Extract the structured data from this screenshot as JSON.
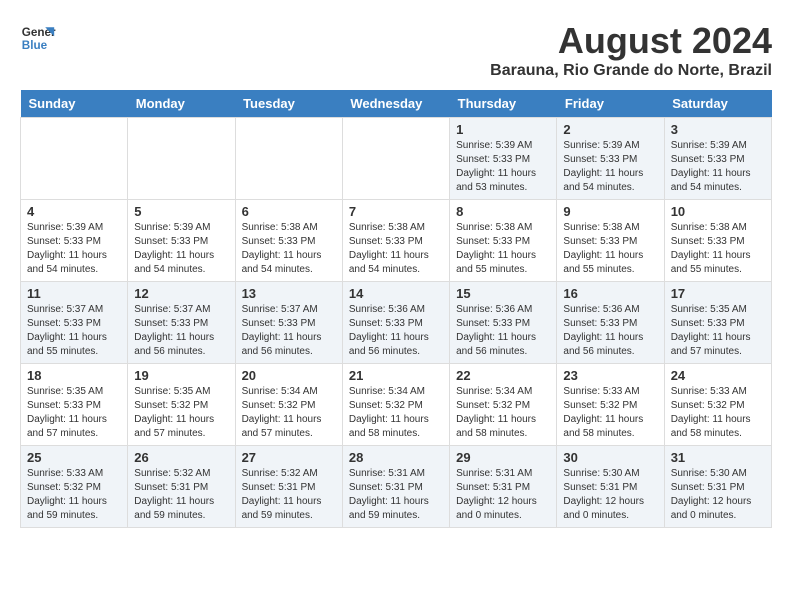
{
  "logo": {
    "line1": "General",
    "line2": "Blue"
  },
  "title": "August 2024",
  "subtitle": "Barauna, Rio Grande do Norte, Brazil",
  "weekdays": [
    "Sunday",
    "Monday",
    "Tuesday",
    "Wednesday",
    "Thursday",
    "Friday",
    "Saturday"
  ],
  "weeks": [
    [
      {
        "day": "",
        "info": ""
      },
      {
        "day": "",
        "info": ""
      },
      {
        "day": "",
        "info": ""
      },
      {
        "day": "",
        "info": ""
      },
      {
        "day": "1",
        "info": "Sunrise: 5:39 AM\nSunset: 5:33 PM\nDaylight: 11 hours and 53 minutes."
      },
      {
        "day": "2",
        "info": "Sunrise: 5:39 AM\nSunset: 5:33 PM\nDaylight: 11 hours and 54 minutes."
      },
      {
        "day": "3",
        "info": "Sunrise: 5:39 AM\nSunset: 5:33 PM\nDaylight: 11 hours and 54 minutes."
      }
    ],
    [
      {
        "day": "4",
        "info": "Sunrise: 5:39 AM\nSunset: 5:33 PM\nDaylight: 11 hours and 54 minutes."
      },
      {
        "day": "5",
        "info": "Sunrise: 5:39 AM\nSunset: 5:33 PM\nDaylight: 11 hours and 54 minutes."
      },
      {
        "day": "6",
        "info": "Sunrise: 5:38 AM\nSunset: 5:33 PM\nDaylight: 11 hours and 54 minutes."
      },
      {
        "day": "7",
        "info": "Sunrise: 5:38 AM\nSunset: 5:33 PM\nDaylight: 11 hours and 54 minutes."
      },
      {
        "day": "8",
        "info": "Sunrise: 5:38 AM\nSunset: 5:33 PM\nDaylight: 11 hours and 55 minutes."
      },
      {
        "day": "9",
        "info": "Sunrise: 5:38 AM\nSunset: 5:33 PM\nDaylight: 11 hours and 55 minutes."
      },
      {
        "day": "10",
        "info": "Sunrise: 5:38 AM\nSunset: 5:33 PM\nDaylight: 11 hours and 55 minutes."
      }
    ],
    [
      {
        "day": "11",
        "info": "Sunrise: 5:37 AM\nSunset: 5:33 PM\nDaylight: 11 hours and 55 minutes."
      },
      {
        "day": "12",
        "info": "Sunrise: 5:37 AM\nSunset: 5:33 PM\nDaylight: 11 hours and 56 minutes."
      },
      {
        "day": "13",
        "info": "Sunrise: 5:37 AM\nSunset: 5:33 PM\nDaylight: 11 hours and 56 minutes."
      },
      {
        "day": "14",
        "info": "Sunrise: 5:36 AM\nSunset: 5:33 PM\nDaylight: 11 hours and 56 minutes."
      },
      {
        "day": "15",
        "info": "Sunrise: 5:36 AM\nSunset: 5:33 PM\nDaylight: 11 hours and 56 minutes."
      },
      {
        "day": "16",
        "info": "Sunrise: 5:36 AM\nSunset: 5:33 PM\nDaylight: 11 hours and 56 minutes."
      },
      {
        "day": "17",
        "info": "Sunrise: 5:35 AM\nSunset: 5:33 PM\nDaylight: 11 hours and 57 minutes."
      }
    ],
    [
      {
        "day": "18",
        "info": "Sunrise: 5:35 AM\nSunset: 5:33 PM\nDaylight: 11 hours and 57 minutes."
      },
      {
        "day": "19",
        "info": "Sunrise: 5:35 AM\nSunset: 5:32 PM\nDaylight: 11 hours and 57 minutes."
      },
      {
        "day": "20",
        "info": "Sunrise: 5:34 AM\nSunset: 5:32 PM\nDaylight: 11 hours and 57 minutes."
      },
      {
        "day": "21",
        "info": "Sunrise: 5:34 AM\nSunset: 5:32 PM\nDaylight: 11 hours and 58 minutes."
      },
      {
        "day": "22",
        "info": "Sunrise: 5:34 AM\nSunset: 5:32 PM\nDaylight: 11 hours and 58 minutes."
      },
      {
        "day": "23",
        "info": "Sunrise: 5:33 AM\nSunset: 5:32 PM\nDaylight: 11 hours and 58 minutes."
      },
      {
        "day": "24",
        "info": "Sunrise: 5:33 AM\nSunset: 5:32 PM\nDaylight: 11 hours and 58 minutes."
      }
    ],
    [
      {
        "day": "25",
        "info": "Sunrise: 5:33 AM\nSunset: 5:32 PM\nDaylight: 11 hours and 59 minutes."
      },
      {
        "day": "26",
        "info": "Sunrise: 5:32 AM\nSunset: 5:31 PM\nDaylight: 11 hours and 59 minutes."
      },
      {
        "day": "27",
        "info": "Sunrise: 5:32 AM\nSunset: 5:31 PM\nDaylight: 11 hours and 59 minutes."
      },
      {
        "day": "28",
        "info": "Sunrise: 5:31 AM\nSunset: 5:31 PM\nDaylight: 11 hours and 59 minutes."
      },
      {
        "day": "29",
        "info": "Sunrise: 5:31 AM\nSunset: 5:31 PM\nDaylight: 12 hours and 0 minutes."
      },
      {
        "day": "30",
        "info": "Sunrise: 5:30 AM\nSunset: 5:31 PM\nDaylight: 12 hours and 0 minutes."
      },
      {
        "day": "31",
        "info": "Sunrise: 5:30 AM\nSunset: 5:31 PM\nDaylight: 12 hours and 0 minutes."
      }
    ]
  ]
}
